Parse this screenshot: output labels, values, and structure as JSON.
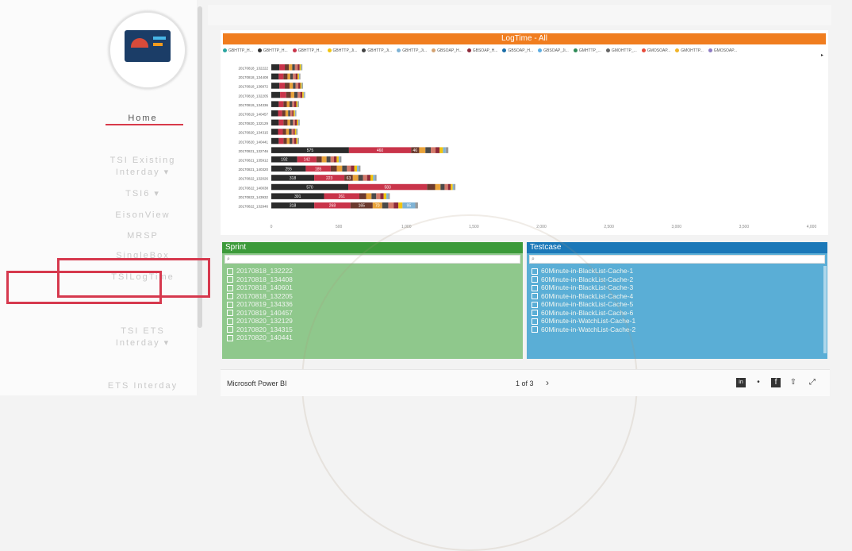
{
  "nav": {
    "items": [
      "Home",
      "TSI Existing",
      "Interday ▾",
      "TSI6 ▾",
      "EisonView",
      "MRSP",
      "SingleBox",
      "TSILogTime",
      "TSI ETS",
      "Interday ▾",
      "ETS Interday"
    ]
  },
  "chart_data": {
    "type": "bar",
    "stacked": true,
    "orientation": "horizontal",
    "title": "LogTime - All",
    "legend": [
      "GBHTTP_H...",
      "GBHTTP_H...",
      "GBHTTP_H...",
      "GBHTTP_Ji...",
      "GBHTTP_Ji...",
      "GBHTTP_Ji...",
      "GBSOAP_H...",
      "GBSOAP_H...",
      "GBSOAP_H...",
      "GBSOAP_Ji...",
      "GMHTTP_...",
      "GMOHTTP_...",
      "GMOSOAP...",
      "GMOHTTP...",
      "GMOSOAP..."
    ],
    "legend_colors": [
      "#2aa5a0",
      "#333333",
      "#c9344a",
      "#f1c40f",
      "#444444",
      "#7fb3d5",
      "#d4a373",
      "#8e2a3a",
      "#1b6ea8",
      "#5dade2",
      "#2e8b57",
      "#666666",
      "#e74c3c",
      "#f0b429",
      "#8e7cc3"
    ],
    "categories": [
      "20170818_132222",
      "20170818_134408",
      "20170818_136872",
      "20170818_132205",
      "20170819_134336",
      "20170819_140457",
      "20170820_132129",
      "20170820_134315",
      "20170820_140441",
      "20170821_132746",
      "20170821_135912",
      "20170821_140320",
      "20170822_132026",
      "20170822_140038",
      "20170822_143932",
      "20170822_132946"
    ],
    "segment_colors": [
      "#2b2b2b",
      "#c9344a",
      "#6b3a2e",
      "#e8a23a",
      "#4a4a4a",
      "#d47a6a",
      "#8e2a3a",
      "#f1c40f",
      "#7fb3d5",
      "#999999"
    ],
    "series_values": [
      [
        60,
        40,
        30,
        25,
        20,
        20,
        15,
        10,
        5,
        5
      ],
      [
        55,
        35,
        30,
        20,
        20,
        20,
        15,
        10,
        5,
        5
      ],
      [
        60,
        40,
        35,
        25,
        20,
        20,
        15,
        10,
        5,
        5
      ],
      [
        65,
        45,
        35,
        25,
        25,
        20,
        15,
        10,
        5,
        5
      ],
      [
        55,
        35,
        25,
        20,
        20,
        15,
        15,
        10,
        5,
        5
      ],
      [
        50,
        30,
        25,
        20,
        15,
        15,
        10,
        10,
        5,
        5
      ],
      [
        55,
        35,
        30,
        20,
        20,
        15,
        15,
        10,
        5,
        5
      ],
      [
        50,
        35,
        25,
        20,
        20,
        15,
        10,
        10,
        5,
        5
      ],
      [
        55,
        35,
        25,
        20,
        20,
        15,
        15,
        10,
        5,
        5
      ],
      [
        575,
        460,
        60,
        46,
        40,
        35,
        30,
        25,
        20,
        20
      ],
      [
        192,
        142,
        40,
        35,
        30,
        25,
        20,
        15,
        10,
        10
      ],
      [
        255,
        185,
        45,
        40,
        35,
        30,
        25,
        20,
        15,
        10
      ],
      [
        318,
        223,
        63,
        40,
        35,
        30,
        25,
        20,
        15,
        10
      ],
      [
        570,
        583,
        60,
        40,
        30,
        25,
        20,
        15,
        10,
        10
      ],
      [
        391,
        261,
        50,
        40,
        35,
        30,
        25,
        20,
        15,
        10
      ],
      [
        318,
        268,
        165,
        70,
        45,
        40,
        35,
        30,
        95,
        20
      ]
    ],
    "data_labels": [
      [],
      [],
      [],
      [],
      [],
      [],
      [],
      [],
      [],
      [
        "575",
        "460",
        "46"
      ],
      [
        "192",
        "142"
      ],
      [
        "255",
        "185"
      ],
      [
        "318",
        "223",
        "63"
      ],
      [
        "570",
        "583"
      ],
      [
        "391",
        "261"
      ],
      [
        "318",
        "268",
        "165",
        "70",
        "",
        "",
        "",
        "",
        "95"
      ]
    ],
    "x_ticks": [
      "0",
      "500",
      "1,000",
      "1,500",
      "2,000",
      "2,500",
      "3,000",
      "3,500",
      "4,000"
    ],
    "xlim": [
      0,
      4000
    ]
  },
  "sprint": {
    "title": "Sprint",
    "search_placeholder": "⌕",
    "items": [
      "20170818_132222",
      "20170818_134408",
      "20170818_140601",
      "20170818_132205",
      "20170819_134336",
      "20170819_140457",
      "20170820_132129",
      "20170820_134315",
      "20170820_140441"
    ]
  },
  "testcase": {
    "title": "Testcase",
    "search_placeholder": "⌕",
    "items": [
      "60Minute-in-BlackList-Cache-1",
      "60Minute-in-BlackList-Cache-2",
      "60Minute-in-BlackList-Cache-3",
      "60Minute-in-BlackList-Cache-4",
      "60Minute-in-BlackList-Cache-5",
      "60Minute-in-BlackList-Cache-6",
      "60Minute-in-WatchList-Cache-1",
      "60Minute-in-WatchList-Cache-2"
    ]
  },
  "footer": {
    "brand": "Microsoft Power BI",
    "pager": "1 of 3",
    "next": "›",
    "share_icons": [
      "in",
      "•",
      "f",
      "⇧",
      "⤢"
    ]
  }
}
